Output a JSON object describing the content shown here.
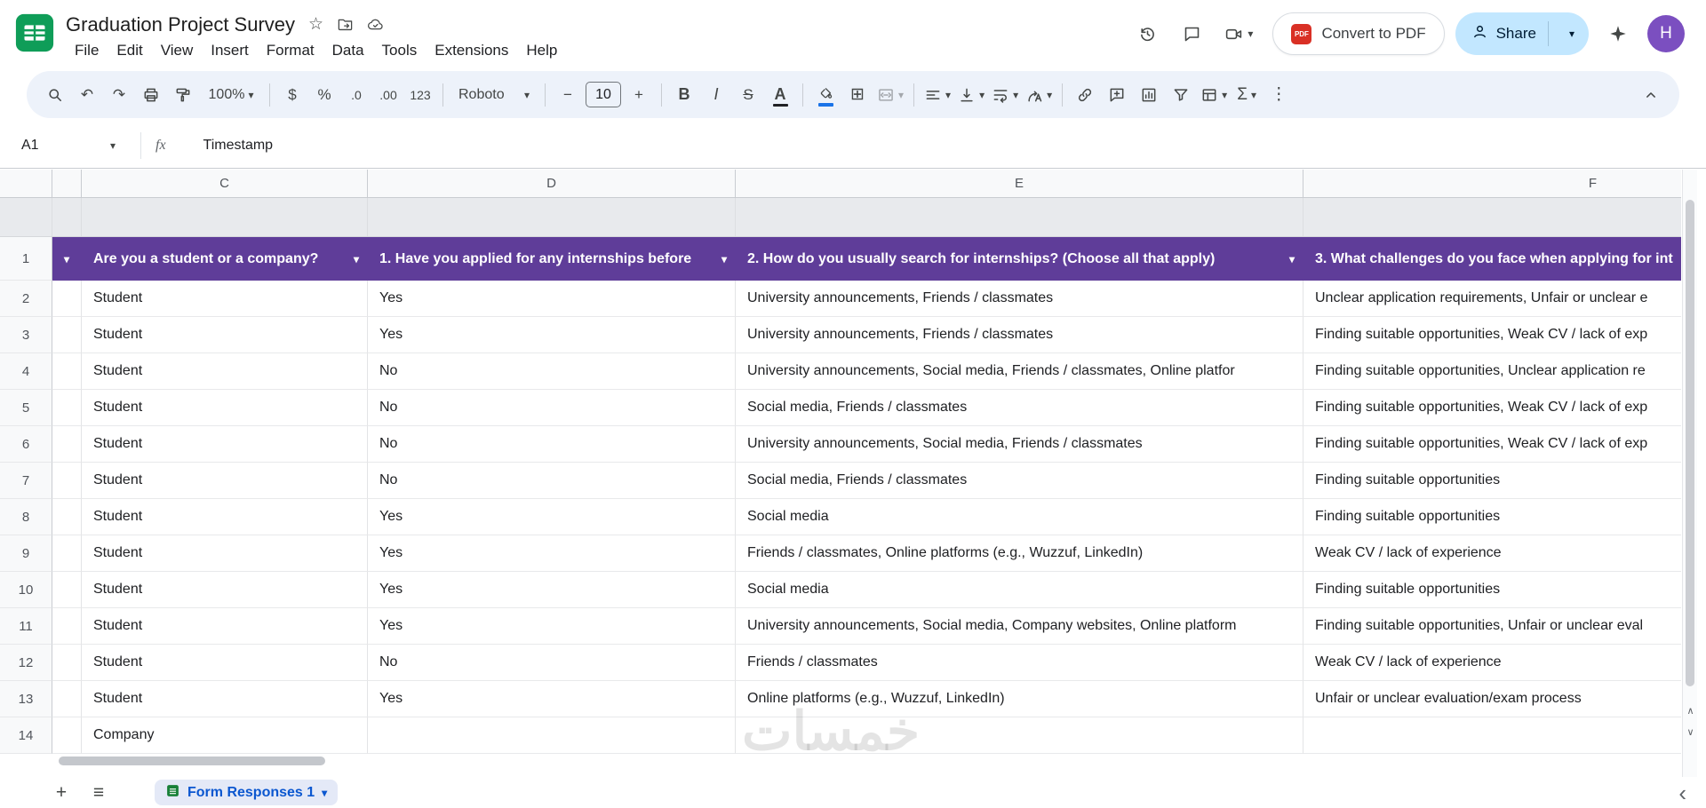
{
  "header": {
    "title": "Graduation Project Survey",
    "menus": [
      "File",
      "Edit",
      "View",
      "Insert",
      "Format",
      "Data",
      "Tools",
      "Extensions",
      "Help"
    ],
    "convert_pdf": "Convert to PDF",
    "pdf_badge": "PDF",
    "share": "Share",
    "avatar": "H"
  },
  "toolbar": {
    "zoom": "100%",
    "font": "Roboto",
    "font_size": "10"
  },
  "glyphs": {
    "star": "☆",
    "undo": "↶",
    "redo": "↷",
    "caret": "▾",
    "minus": "−",
    "plus": "+",
    "bold": "B",
    "italic": "I",
    "strike": "S",
    "color": "A",
    "currency": "$",
    "percent": "%",
    "dec0": ".0",
    "dec00": ".00",
    "n123": "123",
    "borders": "⊞",
    "sum": "Σ",
    "more": "⋮",
    "hamburger": "≡",
    "back": "‹",
    "up": "∧",
    "down": "∨"
  },
  "formula_bar": {
    "cell": "A1",
    "fx": "fx",
    "value": "Timestamp"
  },
  "grid": {
    "cols": [
      "C",
      "D",
      "E",
      "F"
    ],
    "header": {
      "num": "1",
      "c": "Are you a student or a company?",
      "d": "1. Have you applied for any internships before",
      "e": "2. How do you usually search for internships? (Choose all that apply)",
      "f": "3. What challenges do you face when applying for int"
    },
    "rows": [
      {
        "num": "2",
        "c": "Student",
        "d": "Yes",
        "e": "University announcements, Friends / classmates",
        "f": "Unclear application requirements, Unfair or unclear e"
      },
      {
        "num": "3",
        "c": "Student",
        "d": "Yes",
        "e": "University announcements, Friends / classmates",
        "f": "Finding suitable opportunities, Weak CV / lack of exp"
      },
      {
        "num": "4",
        "c": "Student",
        "d": "No",
        "e": "University announcements, Social media, Friends / classmates, Online platfor",
        "f": "Finding suitable opportunities, Unclear application re"
      },
      {
        "num": "5",
        "c": "Student",
        "d": "No",
        "e": "Social media, Friends / classmates",
        "f": "Finding suitable opportunities, Weak CV / lack of exp"
      },
      {
        "num": "6",
        "c": "Student",
        "d": "No",
        "e": "University announcements, Social media, Friends / classmates",
        "f": "Finding suitable opportunities, Weak CV / lack of exp"
      },
      {
        "num": "7",
        "c": "Student",
        "d": "No",
        "e": "Social media, Friends / classmates",
        "f": "Finding suitable opportunities"
      },
      {
        "num": "8",
        "c": "Student",
        "d": "Yes",
        "e": "Social media",
        "f": "Finding suitable opportunities"
      },
      {
        "num": "9",
        "c": "Student",
        "d": "Yes",
        "e": "Friends / classmates, Online platforms (e.g., Wuzzuf, LinkedIn)",
        "f": "Weak CV / lack of experience"
      },
      {
        "num": "10",
        "c": "Student",
        "d": "Yes",
        "e": "Social media",
        "f": "Finding suitable opportunities"
      },
      {
        "num": "11",
        "c": "Student",
        "d": "Yes",
        "e": "University announcements, Social media, Company websites, Online platform",
        "f": "Finding suitable opportunities, Unfair or unclear eval"
      },
      {
        "num": "12",
        "c": "Student",
        "d": "No",
        "e": "Friends / classmates",
        "f": "Weak CV / lack of experience"
      },
      {
        "num": "13",
        "c": "Student",
        "d": "Yes",
        "e": "Online platforms (e.g., Wuzzuf, LinkedIn)",
        "f": "Unfair or unclear evaluation/exam process"
      },
      {
        "num": "14",
        "c": "Company",
        "d": "",
        "e": "",
        "f": ""
      }
    ]
  },
  "sheet_bar": {
    "tab": "Form Responses 1"
  },
  "watermark": "خمسات",
  "colors": {
    "header_row_purple": "#5f3d99",
    "share_pill": "#c2e7ff",
    "active_tab_text": "#0b57d0",
    "avatar": "#7b4fc0",
    "logo_green": "#0f9d58",
    "pdf_red": "#d93025",
    "toolbar_bg": "#edf2fa"
  }
}
